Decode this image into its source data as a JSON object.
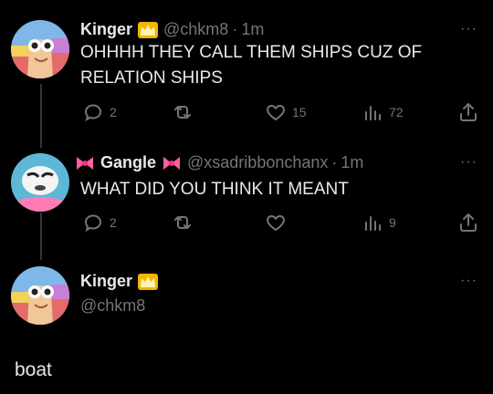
{
  "tweets": [
    {
      "display_name": "Kinger",
      "handle": "@chkm8",
      "sep": "·",
      "time": "1m",
      "text_line1": "OHHHH THEY CALL THEM SHIPS CUZ OF",
      "text_line2": "RELATION SHIPS",
      "replies": "2",
      "retweets": "",
      "likes": "15",
      "views": "72",
      "more": "···"
    },
    {
      "display_name": "Gangle",
      "handle": "@xsadribbonchanx",
      "sep": "·",
      "time": "1m",
      "text_line1": "WHAT DID YOU THINK IT MEANT",
      "replies": "2",
      "retweets": "",
      "likes": "",
      "views": "9",
      "more": "···"
    },
    {
      "display_name": "Kinger",
      "handle": "@chkm8",
      "more": "···"
    }
  ],
  "main_tweet_text": "boat",
  "colors": {
    "background": "#000000",
    "text": "#e7e9ea",
    "muted": "#71767b",
    "crown": "#f4b400",
    "bow": "#ff5fa2"
  }
}
